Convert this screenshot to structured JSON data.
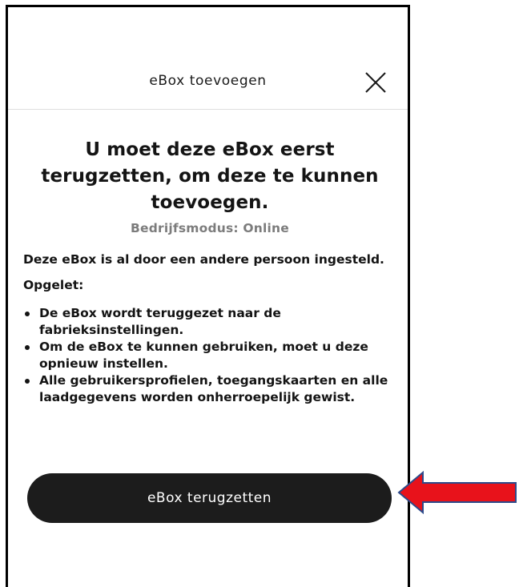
{
  "header": {
    "title": "eBox toevoegen",
    "close_icon": "close-icon"
  },
  "main": {
    "heading": "U moet deze eBox eerst terugzetten, om deze te kunnen toevoegen.",
    "subtitle": "Bedrijfsmodus: Online",
    "description": "Deze eBox is al door een andere persoon ingesteld.",
    "warning_label": "Opgelet:",
    "bullets": [
      "De eBox wordt teruggezet naar de fabrieksinstellingen.",
      "Om de eBox te kunnen gebruiken, moet u deze opnieuw instellen.",
      "Alle gebruikersprofielen, toegangskaarten en alle laadgegevens worden onherroepelijk gewist."
    ],
    "reset_button_label": "eBox terugzetten"
  },
  "annotation": {
    "arrow_icon": "left-arrow-icon",
    "arrow_color": "#e8121b",
    "arrow_border": "#2d4a8a"
  },
  "colors": {
    "button_bg": "#1c1c1c",
    "subtitle_gray": "#7c7c7c",
    "text": "#141414"
  }
}
